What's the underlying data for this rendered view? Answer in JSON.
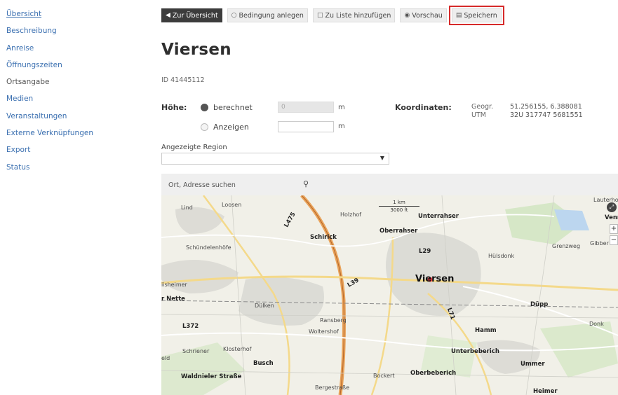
{
  "sidebar": {
    "items": [
      {
        "label": "Übersicht"
      },
      {
        "label": "Beschreibung"
      },
      {
        "label": "Anreise"
      },
      {
        "label": "Öffnungszeiten"
      },
      {
        "label": "Ortsangabe"
      },
      {
        "label": "Medien"
      },
      {
        "label": "Veranstaltungen"
      },
      {
        "label": "Externe Verknüpfungen"
      },
      {
        "label": "Export"
      },
      {
        "label": "Status"
      }
    ]
  },
  "toolbar": {
    "back_label": "Zur Übersicht",
    "condition_label": "Bedingung anlegen",
    "addlist_label": "Zu Liste hinzufügen",
    "preview_label": "Vorschau",
    "save_label": "Speichern"
  },
  "page": {
    "title": "Viersen",
    "id_text": "ID 41445112"
  },
  "hoehe": {
    "label": "Höhe:",
    "option_calculated": "berechnet",
    "option_show": "Anzeigen",
    "calculated_value": "0",
    "unit": "m"
  },
  "koordinaten": {
    "label": "Koordinaten:",
    "geo_label": "Geogr.",
    "geo_value": "51.256155, 6.388081",
    "utm_label": "UTM",
    "utm_value": "32U 317747 5681551"
  },
  "region": {
    "label": "Angezeigte Region",
    "selected": ""
  },
  "map": {
    "search_placeholder": "Ort, Adresse suchen",
    "scale_km": "1 km",
    "scale_ft": "3000 ft",
    "zoom_in": "+",
    "zoom_out": "−",
    "labels": {
      "lind": "Lind",
      "loosen": "Loosen",
      "holzhof": "Holzhof",
      "unterrahser": "Unterrahser",
      "oberrahser": "Oberrahser",
      "schirick": "Schirick",
      "schuendelenhoefe": "Schündelenhöfe",
      "l29": "L29",
      "huelsdonk": "Hülsdonk",
      "grenzweg": "Grenzweg",
      "gibber": "Gibber",
      "lauterhof": "Lauterhof",
      "venn": "Venn",
      "viersen": "Viersen",
      "iisheimer": "iisheimer",
      "rnette": "r Nette",
      "duelken": "Dülken",
      "duepp": "Düpp",
      "ransberg": "Ransberg",
      "woltershof": "Woltershof",
      "l372": "L372",
      "hamm": "Hamm",
      "donk": "Donk",
      "schriener": "Schriener",
      "klosterhof": "Klosterhof",
      "unterbeberich": "Unterbeberich",
      "busch": "Busch",
      "ummer": "Ummer",
      "eld": "eld",
      "waldnieler": "Waldnieler Straße",
      "bockert": "Bockert",
      "oberbeberich": "Oberbeberich",
      "bergestrasse": "Bergestraße",
      "heimer": "Heimer",
      "l475": "L475",
      "l71": "L71",
      "l39": "L39"
    }
  },
  "colors": {
    "link": "#3a6fb0",
    "highlight": "#d62a2a",
    "dark_button": "#3c3c3c"
  }
}
